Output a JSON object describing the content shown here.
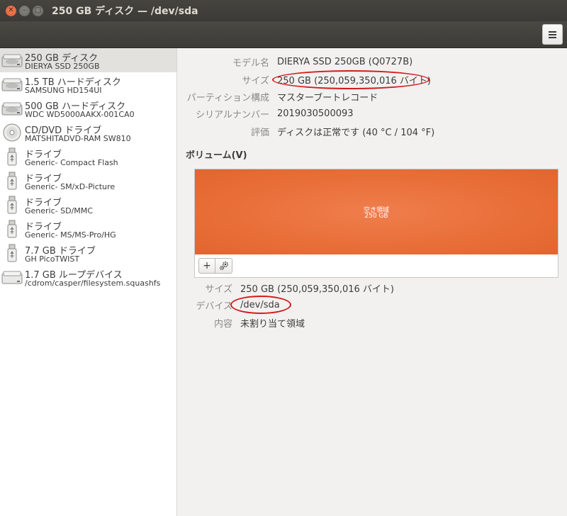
{
  "window": {
    "title": "250 GB ディスク — /dev/sda"
  },
  "header": {
    "menu_icon": "hamburger-menu-icon"
  },
  "sidebar": {
    "devices": [
      {
        "name": "250 GB ディスク",
        "model": "DIERYA SSD 250GB",
        "icon": "harddisk-icon"
      },
      {
        "name": "1.5 TB ハードディスク",
        "model": "SAMSUNG HD154UI",
        "icon": "harddisk-icon"
      },
      {
        "name": "500 GB ハードディスク",
        "model": "WDC WD5000AAKX-001CA0",
        "icon": "harddisk-icon"
      },
      {
        "name": "CD/DVD ドライブ",
        "model": "MATSHITADVD-RAM SW810",
        "icon": "optical-disc-icon"
      },
      {
        "name": "ドライブ",
        "model": "Generic- Compact Flash",
        "icon": "usb-drive-icon"
      },
      {
        "name": "ドライブ",
        "model": "Generic- SM/xD-Picture",
        "icon": "usb-drive-icon"
      },
      {
        "name": "ドライブ",
        "model": "Generic- SD/MMC",
        "icon": "usb-drive-icon"
      },
      {
        "name": "ドライブ",
        "model": "Generic- MS/MS-Pro/HG",
        "icon": "usb-drive-icon"
      },
      {
        "name": "7.7 GB ドライブ",
        "model": "GH PicoTWIST",
        "icon": "usb-drive-icon"
      },
      {
        "name": "1.7 GB ループデバイス",
        "model": "/cdrom/casper/filesystem.squashfs",
        "icon": "loop-device-icon"
      }
    ]
  },
  "disk": {
    "model_label": "モデル名",
    "model_value": "DIERYA SSD 250GB (Q0727B)",
    "size_label": "サイズ",
    "size_value": "250 GB (250,059,350,016 バイト)",
    "partitioning_label": "パーティション構成",
    "partitioning_value": "マスターブートレコード",
    "serial_label": "シリアルナンバー",
    "serial_value": "2019030500093",
    "assessment_label": "評価",
    "assessment_value": "ディスクは正常です (40 °C / 104 °F)"
  },
  "volumes": {
    "title": "ボリューム(V)",
    "segment_title": "空き領域",
    "segment_size": "250 GB",
    "add_button": "+",
    "settings_icon": "gears-icon",
    "size_label": "サイズ",
    "size_value": "250 GB (250,059,350,016 バイト)",
    "device_label": "デバイス",
    "device_value": "/dev/sda",
    "contents_label": "内容",
    "contents_value": "未割り当て領域"
  },
  "colors": {
    "free_space": "#e96f39",
    "highlight_ellipse": "#d41b1b"
  }
}
